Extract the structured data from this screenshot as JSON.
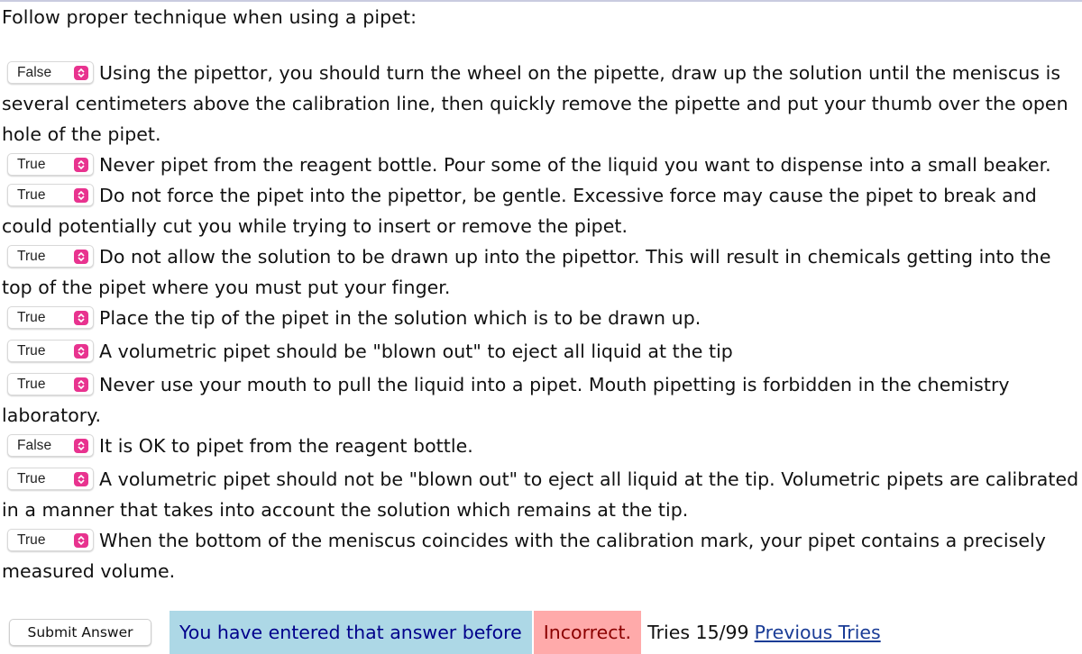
{
  "question": {
    "prompt": "Follow proper technique when using a pipet:",
    "items": [
      {
        "answer": "False",
        "text": "Using the pipettor, you should turn the wheel on the pipette, draw up the solution until the meniscus is several centimeters above the calibration line, then quickly remove the pipette and put your thumb over the open hole of the pipet."
      },
      {
        "answer": "True",
        "text": "Never pipet from the reagent bottle. Pour some of the liquid you want to dispense into a small beaker."
      },
      {
        "answer": "True",
        "text": "Do not force the pipet into the pipettor, be gentle. Excessive force may cause the pipet to break and could potentially cut you while trying to insert or remove the pipet."
      },
      {
        "answer": "True",
        "text": "Do not allow the solution to be drawn up into the pipettor. This will result in chemicals getting into the top of the pipet where you must put your finger."
      },
      {
        "answer": "True",
        "text": "Place the tip of the pipet in the solution which is to be drawn up."
      },
      {
        "answer": "True",
        "text": "A volumetric pipet should be \"blown out\" to eject all liquid at the tip"
      },
      {
        "answer": "True",
        "text": "Never use your mouth to pull the liquid into a pipet. Mouth pipetting is forbidden in the chemistry laboratory."
      },
      {
        "answer": "False",
        "text": "It is OK to pipet from the reagent bottle."
      },
      {
        "answer": "True",
        "text": "A volumetric pipet should not be \"blown out\" to eject all liquid at the tip. Volumetric pipets are calibrated in a manner that takes into account the solution which remains at the tip."
      },
      {
        "answer": "True",
        "text": "When the bottom of the meniscus coincides with the calibration mark, your pipet contains a precisely measured volume."
      }
    ],
    "select_icon": "chevron-up-down-icon",
    "accent_color": "#e8338f"
  },
  "footer": {
    "submit_label": "Submit Answer",
    "message_before": "You have entered that answer before",
    "message_incorrect": "Incorrect.",
    "tries_text": "Tries 15/99",
    "previous_tries_label": "Previous Tries",
    "colors": {
      "before_bg": "#add8e6",
      "before_text": "#00008b",
      "incorrect_bg": "#ffaaaa",
      "incorrect_text": "#8b0000",
      "link": "#1a3c96"
    }
  }
}
